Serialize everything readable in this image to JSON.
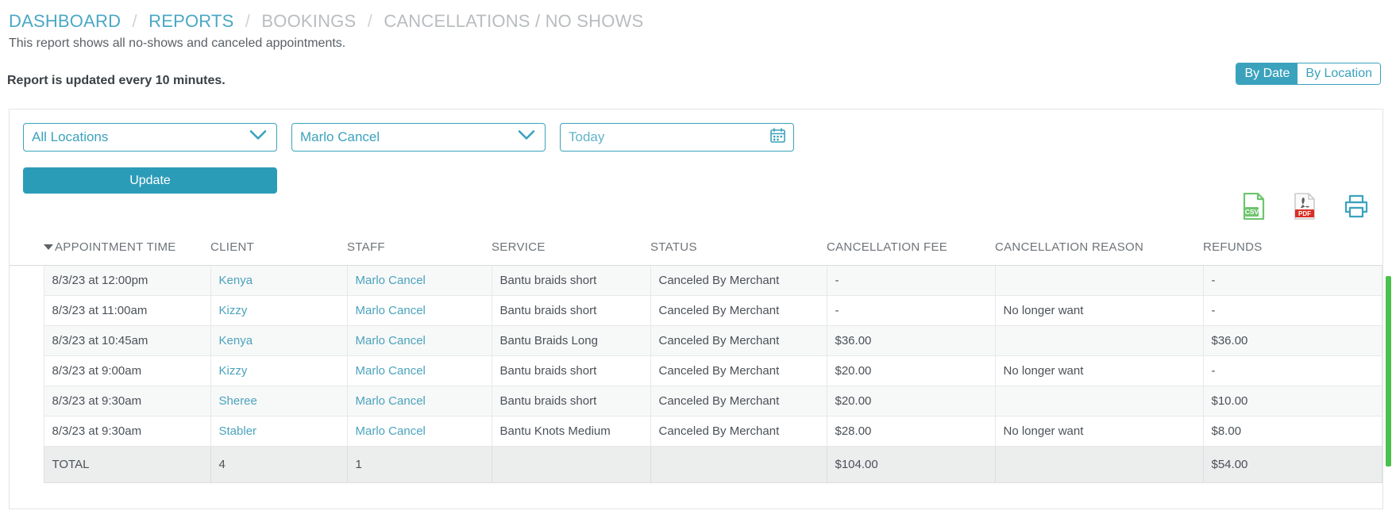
{
  "breadcrumb": {
    "items": [
      {
        "label": "DASHBOARD",
        "muted": false
      },
      {
        "label": "REPORTS",
        "muted": false
      },
      {
        "label": "BOOKINGS",
        "muted": true
      },
      {
        "label": "CANCELLATIONS / NO SHOWS",
        "muted": true
      }
    ],
    "separator": "/"
  },
  "page": {
    "subtitle": "This report shows all no-shows and canceled appointments.",
    "updated_note": "Report is updated every 10 minutes."
  },
  "view_toggle": {
    "by_date": "By Date",
    "by_location": "By Location",
    "active": "By Date"
  },
  "filters": {
    "location": {
      "value": "All Locations",
      "icon": "chevron-down-icon"
    },
    "staff": {
      "value": "Marlo Cancel",
      "icon": "chevron-down-icon"
    },
    "date": {
      "value": "Today",
      "icon": "calendar-icon"
    },
    "update_label": "Update"
  },
  "exports": {
    "csv": "CSV",
    "pdf": "PDF",
    "print": "Print"
  },
  "table": {
    "columns": [
      "APPOINTMENT TIME",
      "CLIENT",
      "STAFF",
      "SERVICE",
      "STATUS",
      "CANCELLATION FEE",
      "CANCELLATION REASON",
      "REFUNDS"
    ],
    "sorted_by": "APPOINTMENT TIME",
    "rows": [
      {
        "time": "8/3/23 at 12:00pm",
        "client": "Kenya",
        "staff": "Marlo Cancel",
        "service": "Bantu braids short",
        "status": "Canceled By Merchant",
        "fee": "-",
        "reason": "",
        "refund": "-",
        "refund_highlight": false
      },
      {
        "time": "8/3/23 at 11:00am",
        "client": "Kizzy",
        "staff": "Marlo Cancel",
        "service": "Bantu braids short",
        "status": "Canceled By Merchant",
        "fee": "-",
        "reason": "No longer want",
        "refund": "-",
        "refund_highlight": false
      },
      {
        "time": "8/3/23 at 10:45am",
        "client": "Kenya",
        "staff": "Marlo Cancel",
        "service": "Bantu Braids Long",
        "status": "Canceled By Merchant",
        "fee": "$36.00",
        "reason": "",
        "refund": "$36.00",
        "refund_highlight": true
      },
      {
        "time": "8/3/23 at 9:00am",
        "client": "Kizzy",
        "staff": "Marlo Cancel",
        "service": "Bantu braids short",
        "status": "Canceled By Merchant",
        "fee": "$20.00",
        "reason": "No longer want",
        "refund": "-",
        "refund_highlight": false
      },
      {
        "time": "8/3/23 at 9:30am",
        "client": "Sheree",
        "staff": "Marlo Cancel",
        "service": "Bantu braids short",
        "status": "Canceled By Merchant",
        "fee": "$20.00",
        "reason": "",
        "refund": "$10.00",
        "refund_highlight": true
      },
      {
        "time": "8/3/23 at 9:30am",
        "client": "Stabler",
        "staff": "Marlo Cancel",
        "service": "Bantu Knots Medium",
        "status": "Canceled By Merchant",
        "fee": "$28.00",
        "reason": "No longer want",
        "refund": "$8.00",
        "refund_highlight": true
      }
    ],
    "total": {
      "label": "TOTAL",
      "client": "4",
      "staff": "1",
      "service": "",
      "status": "",
      "fee": "$104.00",
      "reason": "",
      "refund": "$54.00"
    }
  },
  "colors": {
    "accent": "#3ba2bd",
    "link": "#4aa3bd",
    "refund": "#e8462d",
    "muted": "#b9bdc0",
    "scrollbar": "#4cc04c"
  }
}
